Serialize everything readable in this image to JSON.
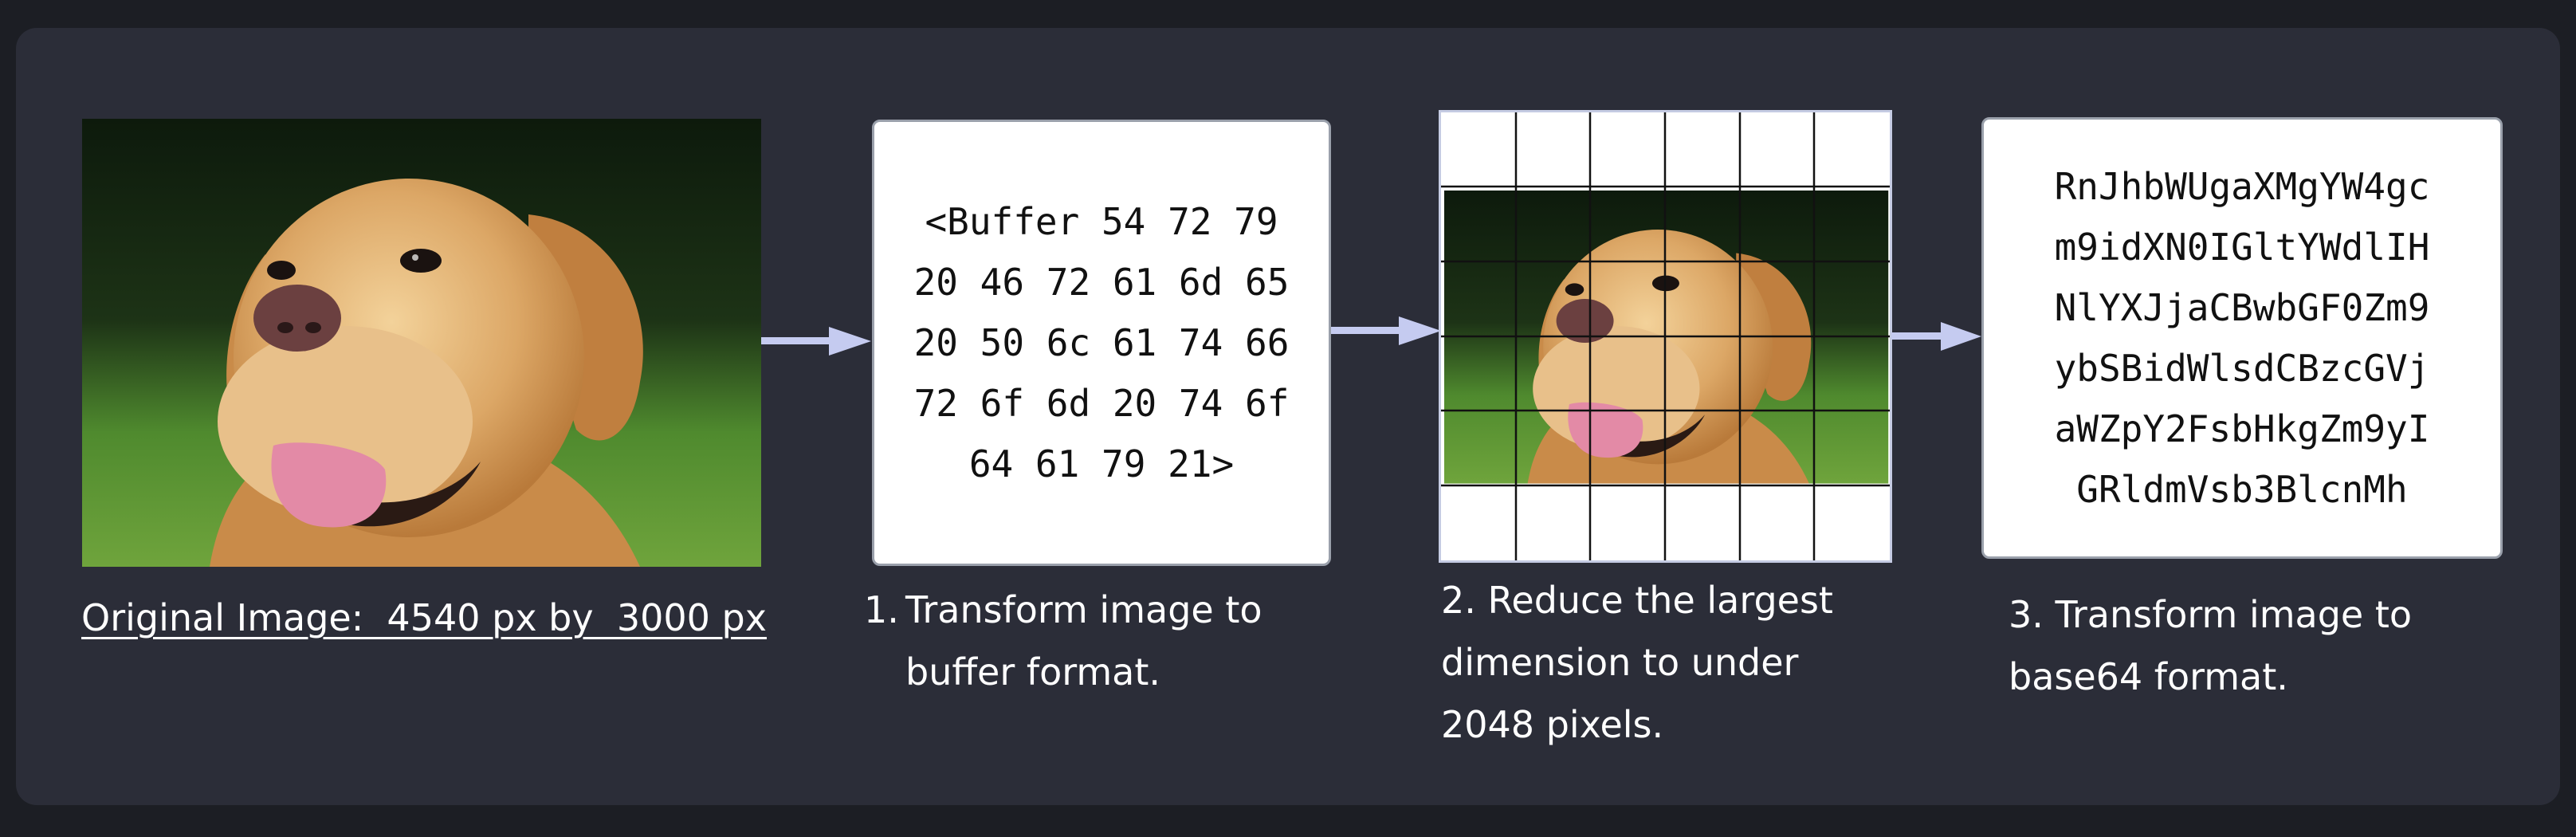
{
  "original": {
    "caption": "Original Image:  4540 px by  3000 px"
  },
  "buffer_card": {
    "lines": [
      "<Buffer 54 72 79",
      "20 46 72 61 6d 65",
      "20 50 6c 61 74 66",
      "72 6f 6d 20 74 6f",
      "64 61 79 21>"
    ]
  },
  "base64_card": {
    "lines": [
      "RnJhbWUgaXMgYW4gc",
      "m9idXN0IGltYWdlIH",
      "NlYXJjaCBwbGF0Zm9",
      "ybSBidWlsdCBzcGVj",
      "aWZpY2FsbHkgZm9yI",
      "GRldmVsb3BlcnMh"
    ]
  },
  "steps": {
    "step1_num": "1.",
    "step1_text": "Transform image to buffer format.",
    "step2_text": "2. Reduce the largest dimension to under 2048 pixels.",
    "step3_text": "3. Transform image to base64 format."
  },
  "colors": {
    "background": "#1c1e24",
    "panel": "#2b2d38",
    "arrow": "#c5cbf0",
    "text": "#ffffff"
  }
}
